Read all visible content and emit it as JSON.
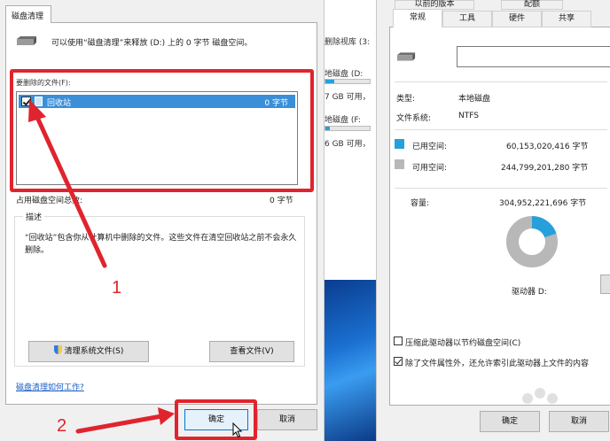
{
  "cleanup": {
    "tab_label": "磁盘清理",
    "intro": "可以使用“磁盘清理”来释放 (D:) 上的 0 字节 磁盘空间。",
    "files_label": "要删除的文件(F):",
    "file_item": {
      "name": "回收站",
      "size": "0 字节",
      "checked": true
    },
    "total_label": "占用磁盘空间总数:",
    "total_value": "0 字节",
    "desc_title": "描述",
    "desc_text": "“回收站”包含你从计算机中删除的文件。这些文件在清空回收站之前不会永久删除。",
    "clean_system_label": "清理系统文件(S)",
    "view_files_label": "查看文件(V)",
    "help_link": "磁盘清理如何工作?",
    "ok_label": "确定",
    "cancel_label": "取消"
  },
  "annotations": {
    "step1": "1",
    "step2": "2",
    "accent": "#e0242e"
  },
  "explorer": {
    "row1": "删除视库 (3:",
    "row2": "地磁盘 (D:",
    "row2_free": "7 GB 可用，",
    "row2_used": 0.2,
    "row3": "地磁盘 (F:",
    "row3_free": "6 GB 可用，",
    "row3_used": 0.1
  },
  "props": {
    "tabs_back": [
      "以前的版本",
      "配额"
    ],
    "tabs": [
      "常规",
      "工具",
      "硬件",
      "共享"
    ],
    "type_label": "类型:",
    "type_value": "本地磁盘",
    "fs_label": "文件系统:",
    "fs_value": "NTFS",
    "used_label": "已用空间:",
    "used_value": "60,153,020,416 字节",
    "free_label": "可用空间:",
    "free_value": "244,799,201,280 字节",
    "cap_label": "容量:",
    "cap_value": "304,952,221,696 字节",
    "used_fraction": 0.197,
    "used_color": "#26a0da",
    "free_color": "#b8b8b8",
    "drive_label": "驱动器 D:",
    "compress_label": "压缩此驱动器以节约磁盘空间(C)",
    "index_label": "除了文件属性外，还允许索引此驱动器上文件的内容",
    "ok_label": "确定",
    "cancel_label": "取消"
  }
}
